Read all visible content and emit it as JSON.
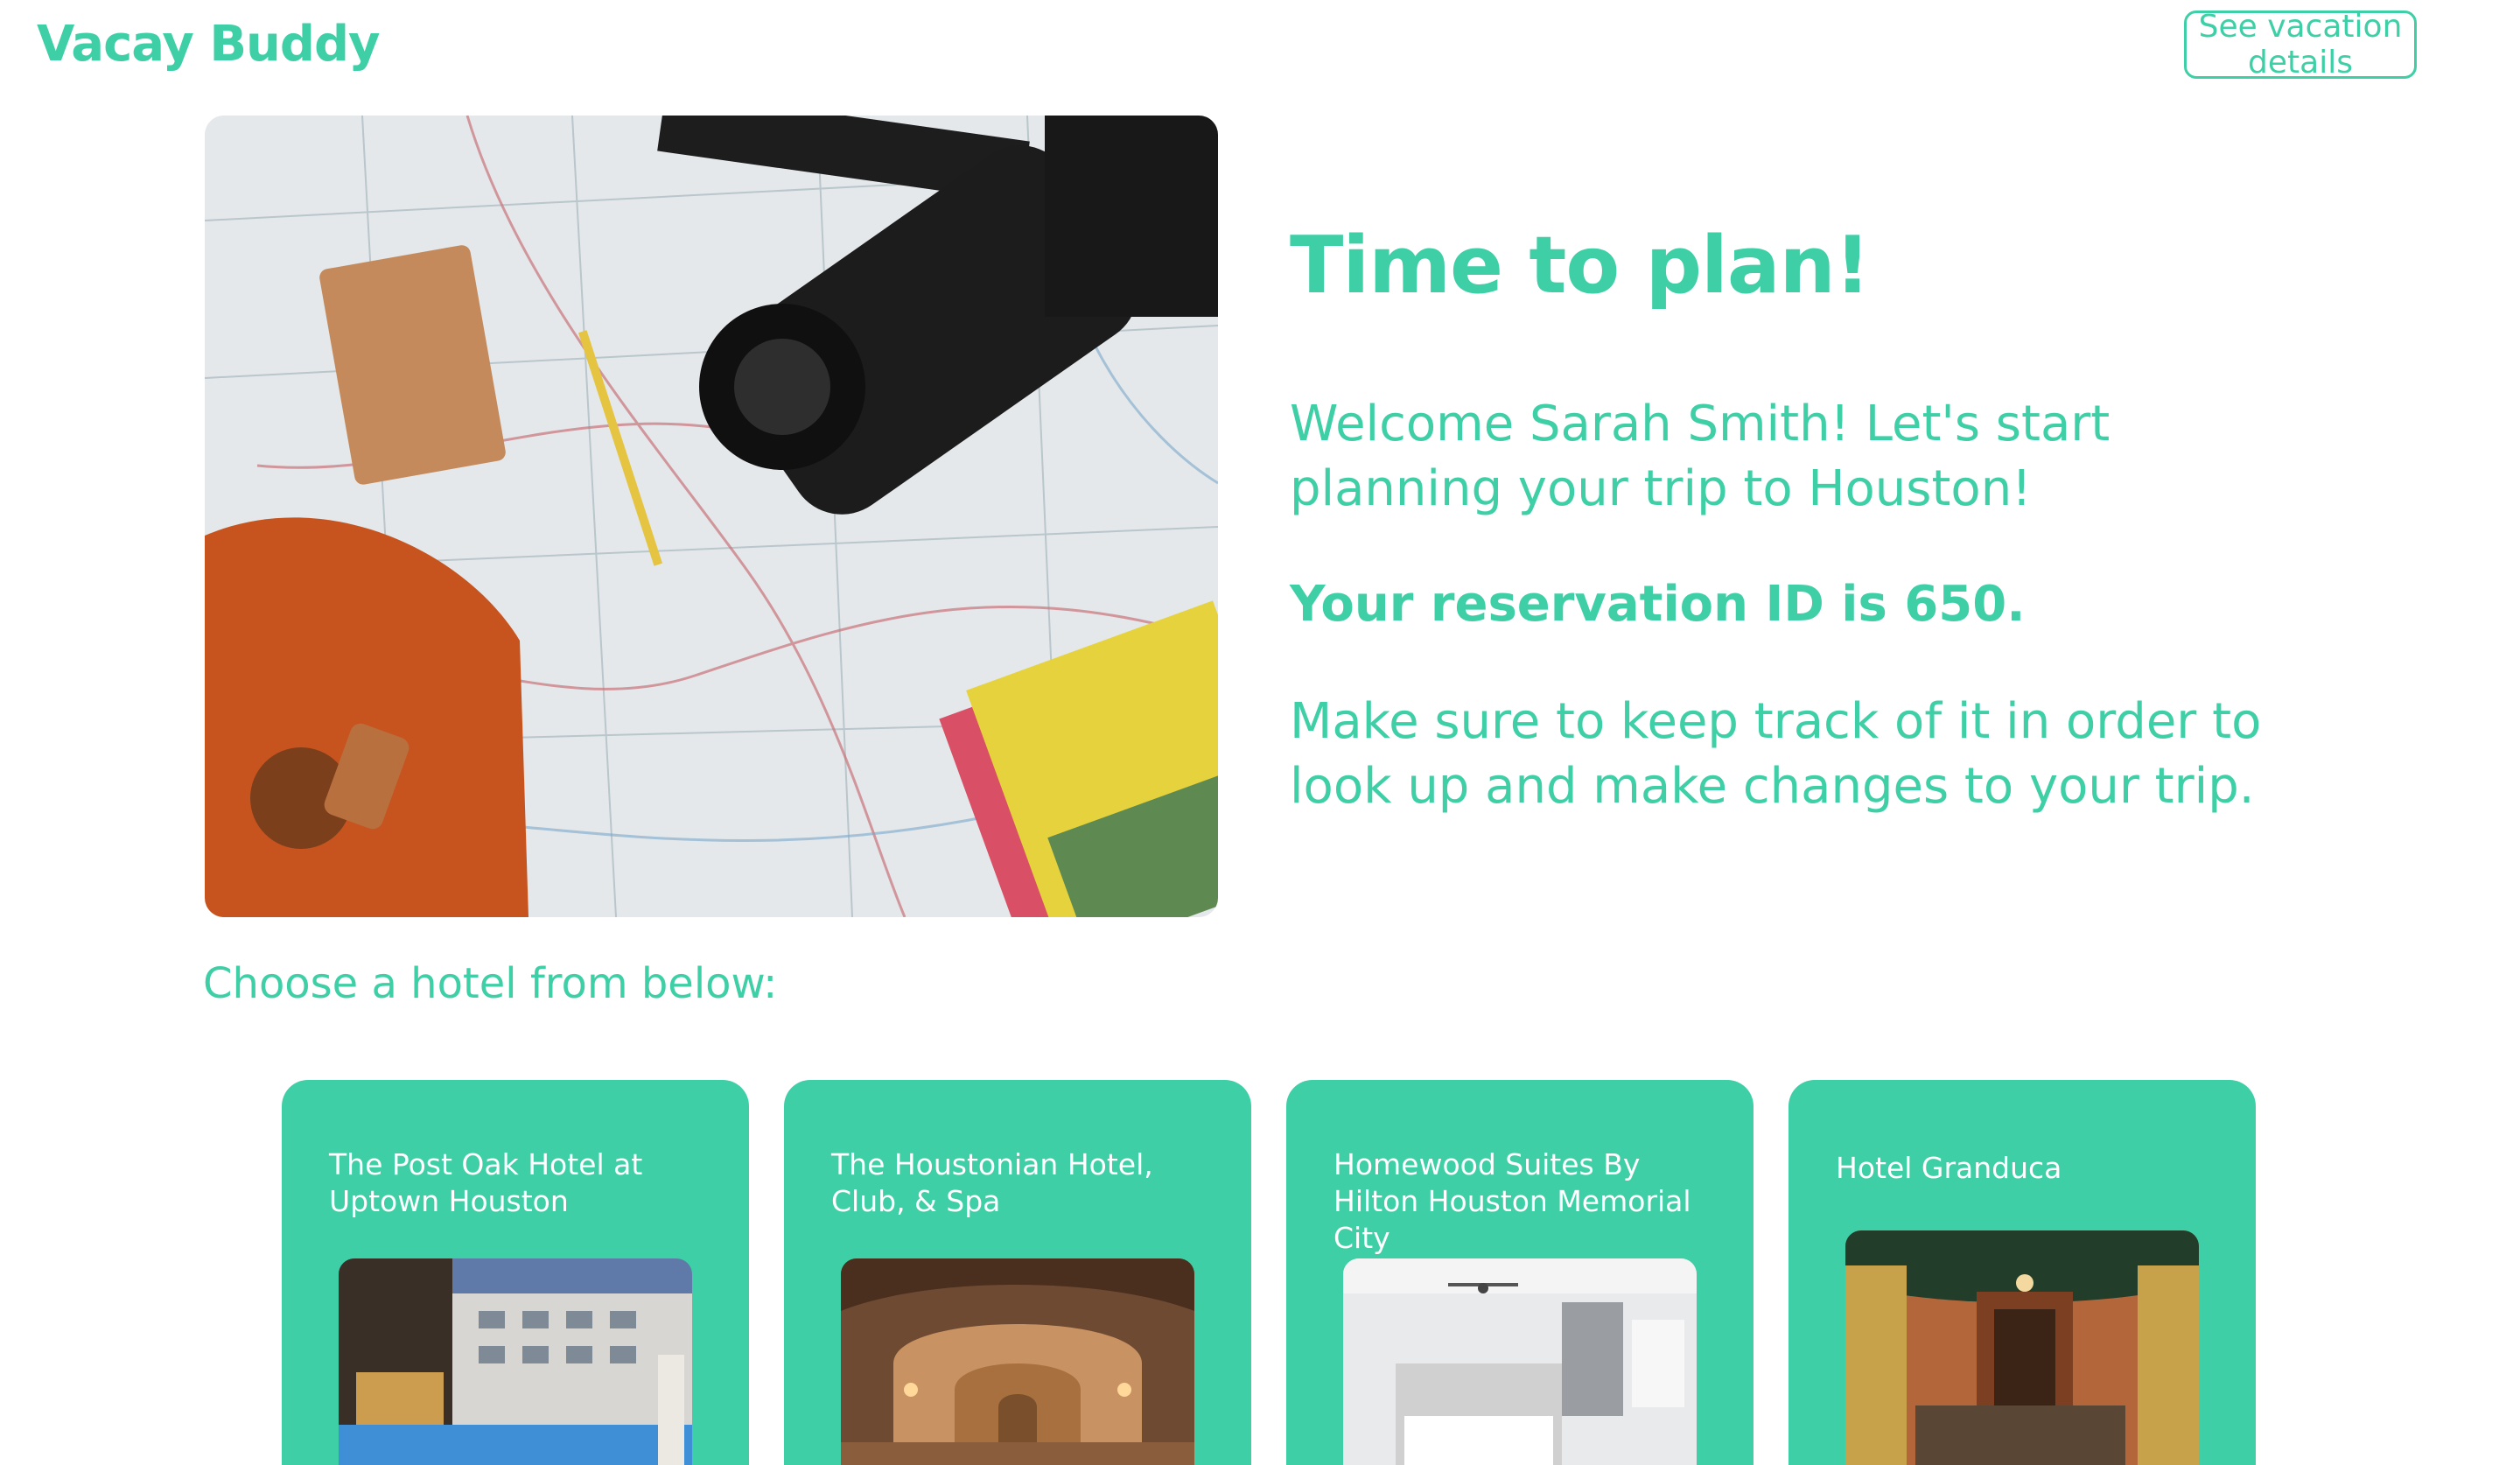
{
  "header": {
    "brand": "Vacay Buddy",
    "details_button": "See vacation details"
  },
  "hero": {
    "image_icon": "travel-flatlay-photo",
    "title": "Time to plan!",
    "welcome": "Welcome Sarah Smith! Let's start planning your trip to Houston!",
    "reservation": "Your reservation ID is 650.",
    "keep_track": "Make sure to keep track of it in order to look up and make changes to your trip."
  },
  "hotels": {
    "heading": "Choose a hotel from below:",
    "items": [
      {
        "name": "The Post Oak Hotel at Uptown Houston"
      },
      {
        "name": "The Houstonian Hotel, Club, & Spa"
      },
      {
        "name": "Homewood Suites By Hilton Houston Memorial City"
      },
      {
        "name": "Hotel Granduca"
      }
    ]
  },
  "colors": {
    "accent": "#3fcfa6",
    "background": "#ffffff",
    "card_text": "#ffffff"
  }
}
